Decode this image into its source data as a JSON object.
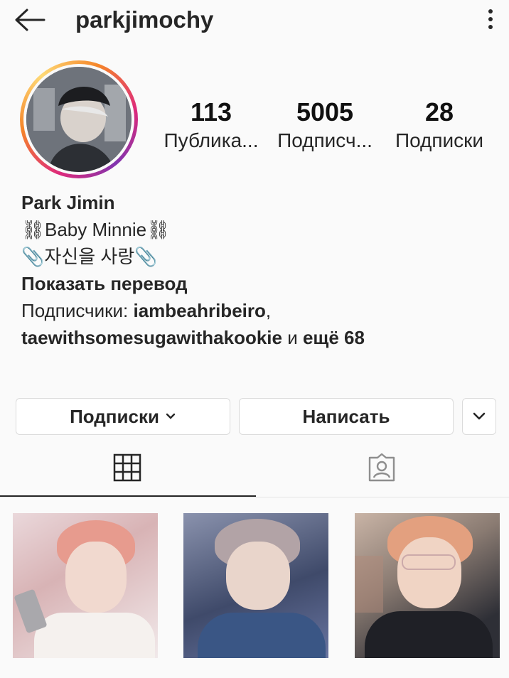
{
  "header": {
    "username": "parkjimochy",
    "back_icon": "arrow-left-icon",
    "more_icon": "more-vertical-icon"
  },
  "stats": {
    "posts_count": "113",
    "posts_label": "Публика...",
    "followers_count": "5005",
    "followers_label": "Подписч...",
    "following_count": "28",
    "following_label": "Подписки"
  },
  "bio": {
    "name": "Park Jimin",
    "line1": "⛓Baby Minnie⛓",
    "line2": "📎자신을 사랑📎",
    "translate": "Показать перевод",
    "followed_by_prefix": "Подписчики: ",
    "follower_1": "iambeahribeiro",
    "separator": ",",
    "follower_2": "taewithsomesugawithakookie",
    "and_more_prefix": " и ",
    "and_more": "ещё 68"
  },
  "actions": {
    "following_label": "Подписки",
    "following_chevron": "⌄",
    "message_label": "Написать",
    "more_icon": "chevron-down-icon"
  },
  "tabs": [
    {
      "icon": "grid-icon",
      "active": true
    },
    {
      "icon": "tagged-user-icon",
      "active": false
    }
  ],
  "colors": {
    "text": "#262626",
    "ring_start": "#f58529",
    "ring_mid": "#dd2a7b",
    "border": "#dbdbdb"
  }
}
